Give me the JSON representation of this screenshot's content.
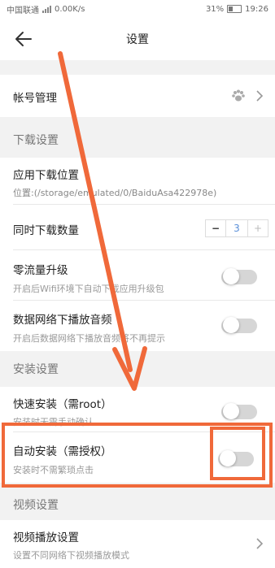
{
  "status_bar": {
    "carrier": "中国联通",
    "net_speed": "0.00K/s",
    "battery": "31%",
    "time": "19:26"
  },
  "header": {
    "title": "设置"
  },
  "account": {
    "label": "帐号管理"
  },
  "sections": {
    "download": "下载设置",
    "install": "安装设置",
    "video": "视频设置"
  },
  "download_location": {
    "label": "应用下载位置",
    "path": "位置:(/storage/emulated/0/BaiduAsa422978e)"
  },
  "concurrent_downloads": {
    "label": "同时下载数量",
    "minus": "−",
    "value": "3",
    "plus": "+"
  },
  "zero_traffic_upgrade": {
    "label": "零流量升级",
    "desc": "开启后Wifi环境下自动下载应用升级包",
    "enabled": false
  },
  "mobile_audio": {
    "label": "数据网络下播放音频",
    "desc": "开启后数据网络下播放音频将不再提示",
    "enabled": false
  },
  "quick_install": {
    "label": "快速安装（需root）",
    "desc": "安装时无需手动确认",
    "enabled": false
  },
  "auto_install": {
    "label": "自动安装（需授权）",
    "desc": "安装时不需繁琐点击",
    "enabled": false
  },
  "video_playback": {
    "label": "视频播放设置",
    "desc": "设置不同网络下视频播放模式"
  },
  "colors": {
    "annotation": "#f0693a",
    "stepper_value": "#5a8fd8"
  },
  "icons": [
    "back-arrow-icon",
    "paw-icon",
    "chevron-right-icon",
    "signal-icon",
    "battery-icon"
  ]
}
